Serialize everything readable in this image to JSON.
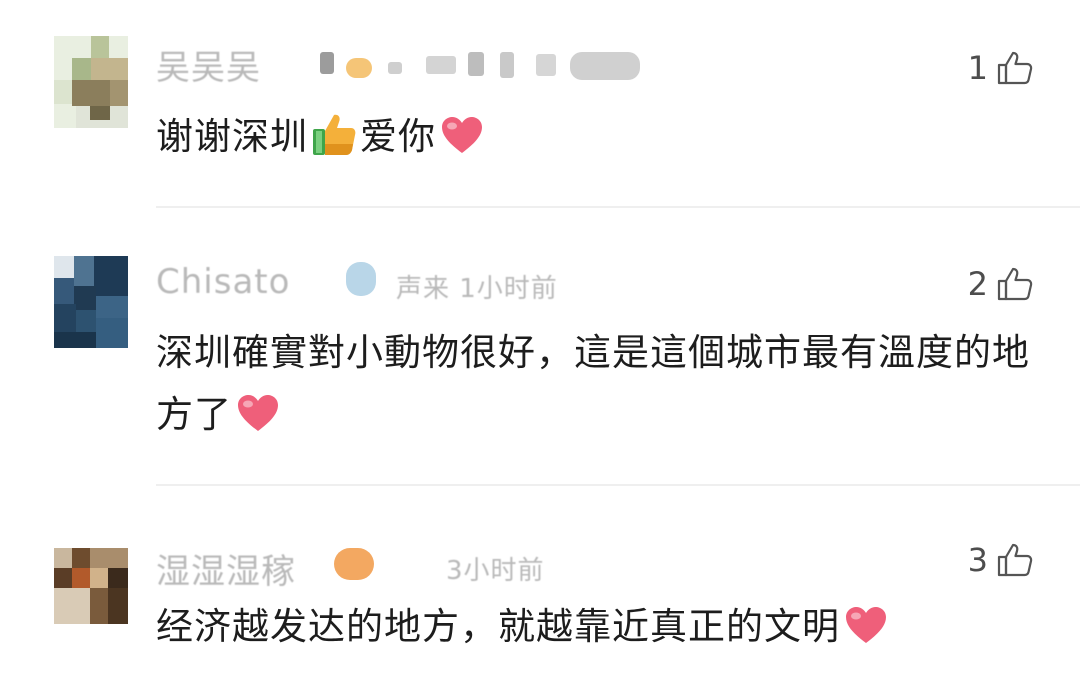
{
  "comments": [
    {
      "username_obscured": "吴吴吴",
      "time_obscured": "",
      "like_count": "1",
      "text": "谢谢深圳",
      "text_after_thumb": "爱你"
    },
    {
      "username_obscured": "Chisato",
      "time_obscured": "声来 1小时前",
      "like_count": "2",
      "text": "深圳確實對小動物很好，這是這個城市最有溫度的地方了"
    },
    {
      "username_obscured": "湿湿湿稼",
      "time_obscured": "3小时前",
      "like_count": "3",
      "text": "经济越发达的地方，就越靠近真正的文明"
    }
  ],
  "icons": {
    "like": "thumbs-up-outline-icon",
    "heart": "red-heart-emoji",
    "thumb_emoji": "thumbs-up-emoji"
  },
  "colors": {
    "heart": "#ef5f7a",
    "divider": "#efefef",
    "text": "#1d1d1d",
    "meta": "#b9b9b9"
  }
}
